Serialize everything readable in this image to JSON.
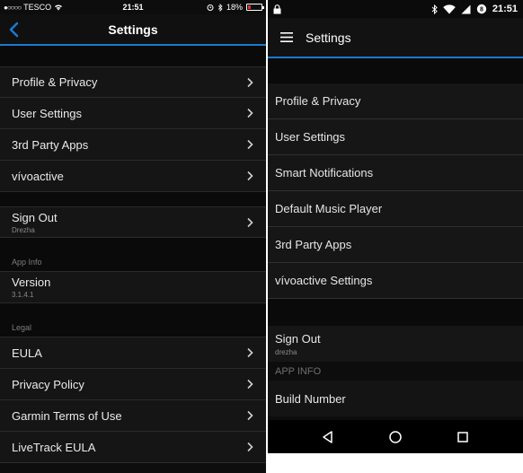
{
  "ios": {
    "status": {
      "carrier": "TESCO",
      "time": "21:51",
      "battery": "18%",
      "battery_level": 0.18
    },
    "nav": {
      "title": "Settings"
    },
    "group1": [
      "Profile & Privacy",
      "User Settings",
      "3rd Party Apps",
      "vívoactive"
    ],
    "signout": {
      "label": "Sign Out",
      "sub": "Drezha"
    },
    "app_info": {
      "header": "App Info",
      "version_label": "Version",
      "version_value": "3.1.4.1"
    },
    "legal": {
      "header": "Legal",
      "items": [
        "EULA",
        "Privacy Policy",
        "Garmin Terms of Use",
        "LiveTrack EULA"
      ]
    }
  },
  "android": {
    "status": {
      "time": "21:51"
    },
    "bar": {
      "title": "Settings"
    },
    "group1": [
      "Profile & Privacy",
      "User Settings",
      "Smart Notifications",
      "Default Music Player",
      "3rd Party Apps",
      "vívoactive Settings"
    ],
    "signout": {
      "label": "Sign Out",
      "sub": "drezha"
    },
    "app_info": {
      "header": "APP INFO",
      "build_label": "Build Number"
    }
  },
  "colors": {
    "accent": "#1a7bd0",
    "battery_low": "#e03030"
  }
}
